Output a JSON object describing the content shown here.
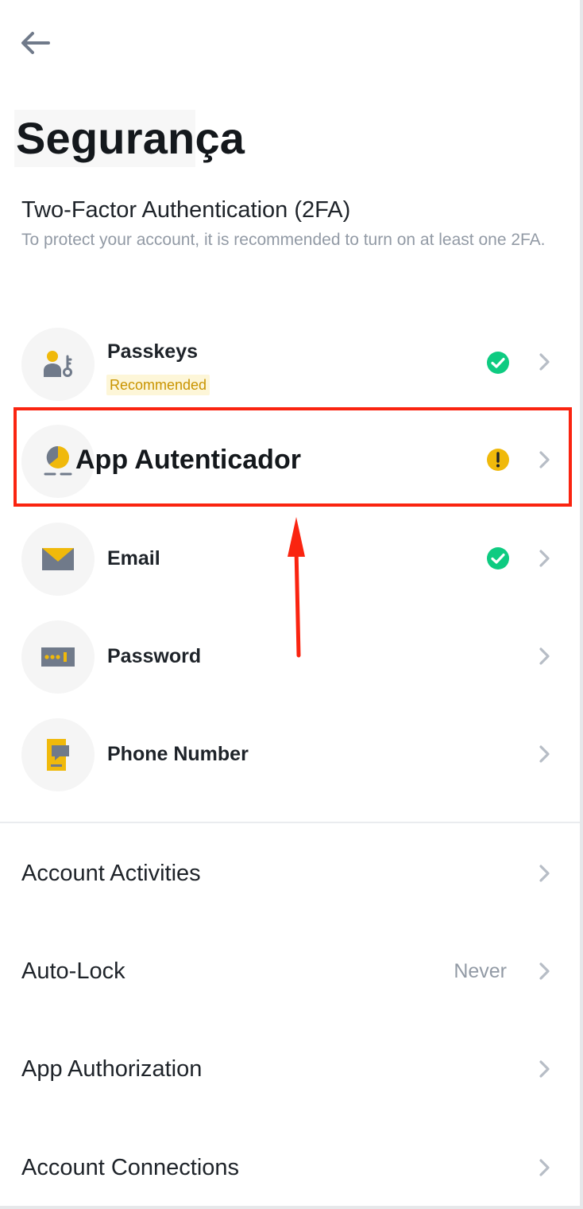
{
  "header": {
    "title": "Segurança"
  },
  "two_fa": {
    "title": "Two-Factor Authentication (2FA)",
    "description": "To protect your account, it is recommended to turn on at least one 2FA.",
    "items": [
      {
        "label": "Passkeys",
        "badge": "Recommended",
        "status": "enabled",
        "icon": "passkey-icon"
      },
      {
        "label": "App Autenticador",
        "status": "warning",
        "icon": "authenticator-icon"
      },
      {
        "label": "Email",
        "status": "enabled",
        "icon": "email-icon"
      },
      {
        "label": "Password",
        "status": "none",
        "icon": "password-icon"
      },
      {
        "label": "Phone Number",
        "status": "none",
        "icon": "phone-icon"
      }
    ]
  },
  "menu": {
    "items": [
      {
        "label": "Account Activities",
        "value": ""
      },
      {
        "label": "Auto-Lock",
        "value": "Never"
      },
      {
        "label": "App Authorization",
        "value": ""
      },
      {
        "label": "Account Connections",
        "value": ""
      }
    ]
  },
  "colors": {
    "brand_yellow": "#f0b90b",
    "success_green": "#0ecb81",
    "warning_yellow": "#f0b90b",
    "annotation_red": "#fa2410",
    "icon_gray": "#707a8a",
    "chevron_gray": "#b7bdc6"
  }
}
